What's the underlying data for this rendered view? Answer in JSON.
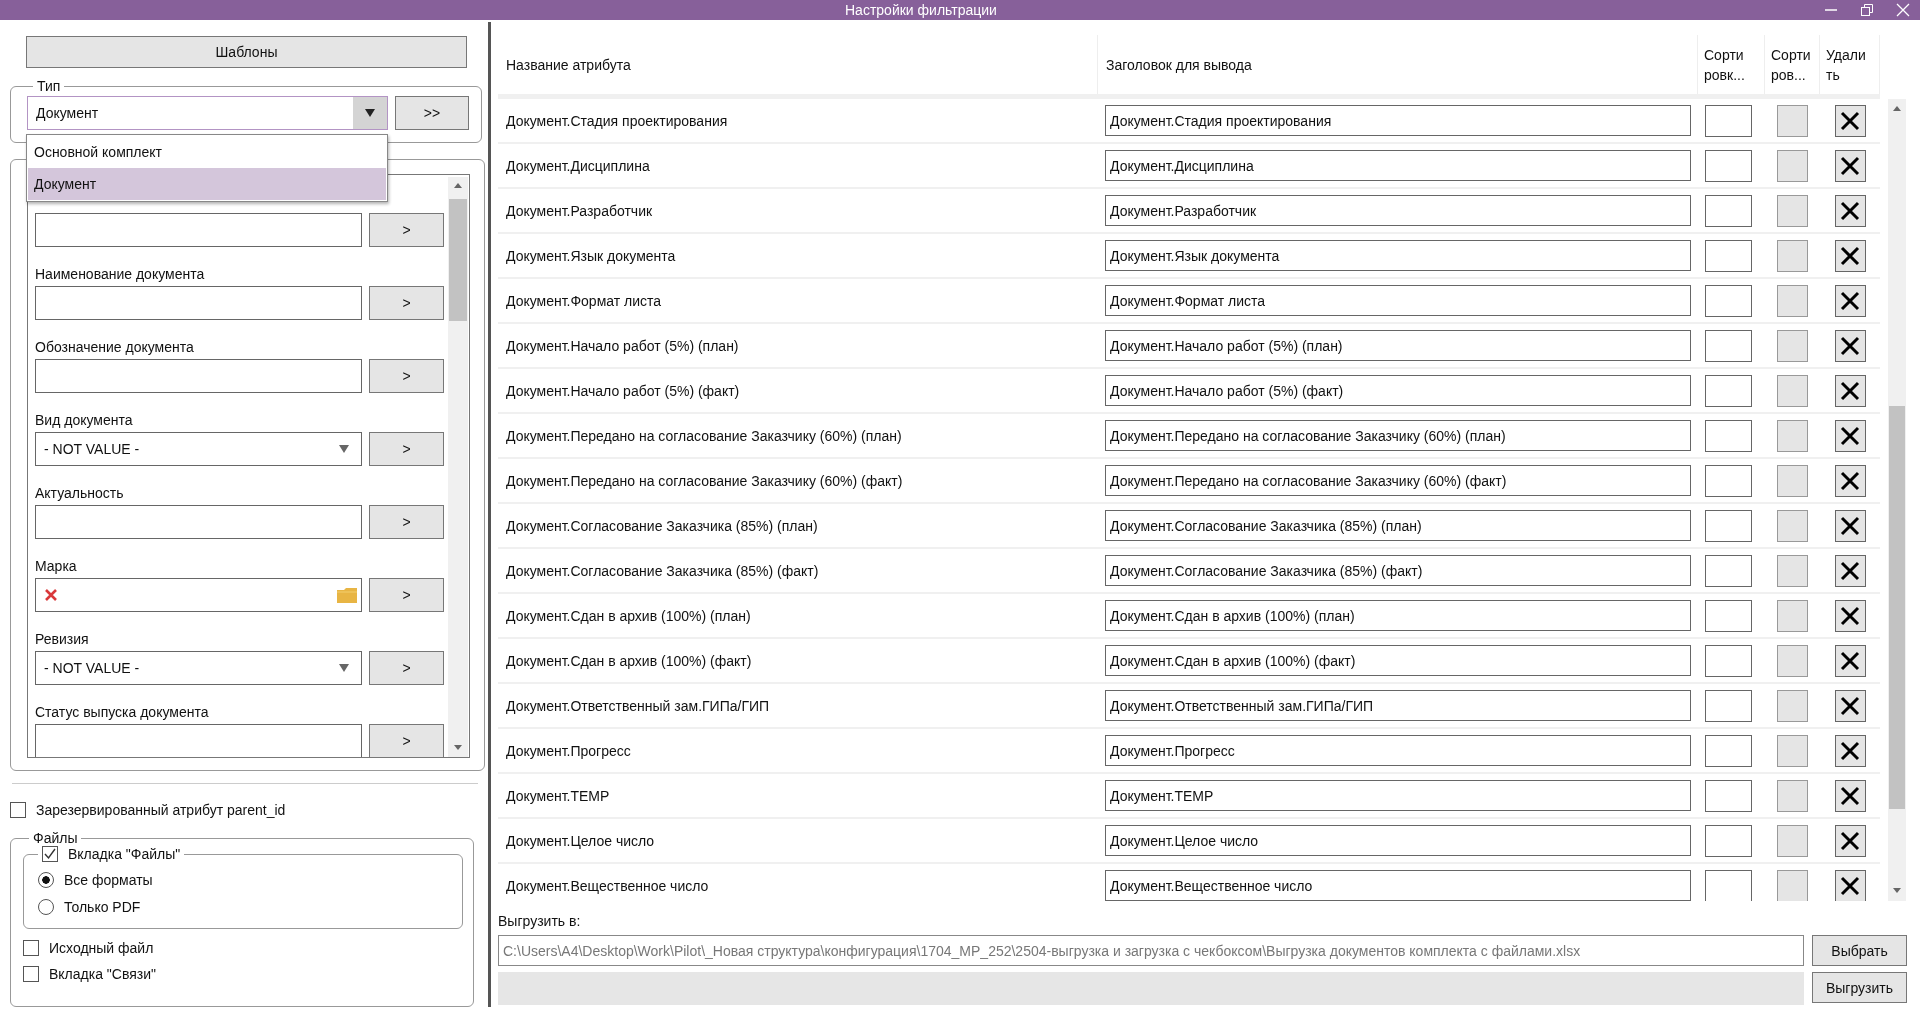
{
  "window": {
    "title": "Настройки фильтрации"
  },
  "templates_button": "Шаблоны",
  "type_group": {
    "label": "Тип",
    "combo": {
      "value": "Документ",
      "expanded": true,
      "options": [
        {
          "label": "Основной комплект",
          "selected": false
        },
        {
          "label": "Документ",
          "selected": true
        }
      ]
    },
    "apply_button": ">>"
  },
  "filter_fields": [
    {
      "kind": "text",
      "button": ">"
    },
    {
      "kind": "text",
      "label": "Наименование документа",
      "button": ">"
    },
    {
      "kind": "text",
      "label": "Обозначение документа",
      "button": ">"
    },
    {
      "kind": "dropdown",
      "label": "Вид документа",
      "value": "- NOT VALUE -",
      "button": ">"
    },
    {
      "kind": "text",
      "label": "Актуальность",
      "button": ">"
    },
    {
      "kind": "reference",
      "label": "Марка",
      "button": ">"
    },
    {
      "kind": "dropdown",
      "label": "Ревизия",
      "value": "- NOT VALUE -",
      "button": ">"
    },
    {
      "kind": "text",
      "label": "Статус выпуска документа",
      "button": ">"
    }
  ],
  "parent_id_checkbox": {
    "label": "Зарезервированный атрибут parent_id",
    "checked": false
  },
  "files_group": {
    "label": "Файлы",
    "files_tab": {
      "label": "Вкладка \"Файлы\"",
      "checked": true,
      "formats": [
        {
          "label": "Все форматы",
          "selected": true
        },
        {
          "label": "Только PDF",
          "selected": false
        }
      ]
    },
    "options": [
      {
        "label": "Исходный файл",
        "checked": false
      },
      {
        "label": "Вкладка \"Связи\"",
        "checked": false
      }
    ]
  },
  "table": {
    "columns": [
      "Название атрибута",
      "Заголовок для вывода",
      "Сорти\nровк...",
      "Сорти\nров...",
      "Удали\nть"
    ],
    "rows": [
      {
        "name": "Документ.Стадия проектирования",
        "title": "Документ.Стадия проектирования"
      },
      {
        "name": "Документ.Дисциплина",
        "title": "Документ.Дисциплина"
      },
      {
        "name": "Документ.Разработчик",
        "title": "Документ.Разработчик"
      },
      {
        "name": "Документ.Язык документа",
        "title": "Документ.Язык документа"
      },
      {
        "name": "Документ.Формат листа",
        "title": "Документ.Формат листа"
      },
      {
        "name": "Документ.Начало работ (5%) (план)",
        "title": "Документ.Начало работ (5%) (план)"
      },
      {
        "name": "Документ.Начало работ (5%) (факт)",
        "title": "Документ.Начало работ (5%) (факт)"
      },
      {
        "name": "Документ.Передано на согласование Заказчику (60%) (план)",
        "title": "Документ.Передано на согласование Заказчику (60%) (план)"
      },
      {
        "name": "Документ.Передано на согласование Заказчику (60%) (факт)",
        "title": "Документ.Передано на согласование Заказчику (60%) (факт)"
      },
      {
        "name": "Документ.Согласование Заказчика (85%) (план)",
        "title": "Документ.Согласование Заказчика (85%) (план)"
      },
      {
        "name": "Документ.Согласование Заказчика (85%) (факт)",
        "title": "Документ.Согласование Заказчика (85%) (факт)"
      },
      {
        "name": "Документ.Сдан в архив (100%) (план)",
        "title": "Документ.Сдан в архив (100%) (план)"
      },
      {
        "name": "Документ.Сдан в архив (100%) (факт)",
        "title": "Документ.Сдан в архив (100%) (факт)"
      },
      {
        "name": "Документ.Ответственный зам.ГИПа/ГИП",
        "title": "Документ.Ответственный зам.ГИПа/ГИП"
      },
      {
        "name": "Документ.Прогресс",
        "title": "Документ.Прогресс"
      },
      {
        "name": "Документ.TEMP",
        "title": "Документ.TEMP"
      },
      {
        "name": "Документ.Целое число",
        "title": "Документ.Целое число"
      },
      {
        "name": "Документ.Вещественное число",
        "title": "Документ.Вещественное число"
      }
    ]
  },
  "export": {
    "label": "Выгрузить в:",
    "path": "C:\\Users\\A4\\Desktop\\Work\\Pilot\\_Новая структура\\конфигурация\\1704_MP_252\\2504-выгрузка и загрузка с чекбоксом\\Выгрузка документов комплекта с файлами.xlsx",
    "browse_button": "Выбрать",
    "export_button": "Выгрузить",
    "progress": {
      "level": 0
    }
  }
}
